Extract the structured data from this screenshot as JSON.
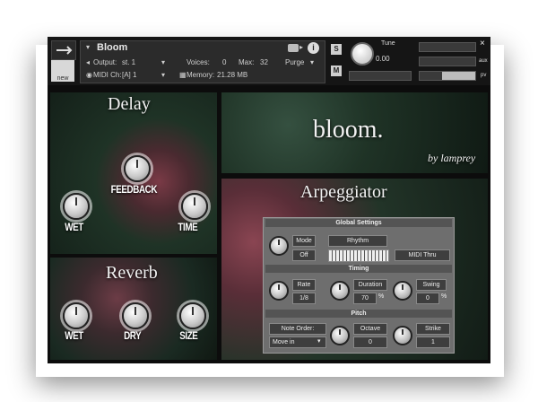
{
  "header": {
    "instrument_name": "Bloom",
    "output_label": "Output:",
    "output_value": "st. 1",
    "voices_label": "Voices:",
    "voices_value": "0",
    "max_label": "Max:",
    "max_value": "32",
    "purge_label": "Purge",
    "midi_label": "MIDI Ch:",
    "midi_value": "[A] 1",
    "memory_label": "Memory:",
    "memory_value": "21.28 MB",
    "new_label": "new",
    "s_label": "S",
    "m_label": "M",
    "tune_label": "Tune",
    "tune_value": "0.00",
    "aux_label": "aux",
    "pv_label": "pv",
    "close_glyph": "×"
  },
  "delay": {
    "title": "Delay",
    "feedback_label": "FEEDBACK",
    "wet_label": "WET",
    "time_label": "TIME"
  },
  "brand": {
    "title": "bloom.",
    "byline": "by lamprey"
  },
  "reverb": {
    "title": "Reverb",
    "wet_label": "WET",
    "dry_label": "DRY",
    "size_label": "SIZE"
  },
  "arpeggiator": {
    "title": "Arpeggiator",
    "global_header": "Global Settings",
    "mode_label": "Mode",
    "mode_value": "Off",
    "rhythm_label": "Rhythm",
    "midi_thru_label": "MIDI Thru",
    "timing_header": "Timing",
    "rate_label": "Rate",
    "rate_value": "1/8",
    "duration_label": "Duration",
    "duration_value": "70",
    "duration_unit": "%",
    "swing_label": "Swing",
    "swing_value": "0",
    "swing_unit": "%",
    "pitch_header": "Pitch",
    "note_order_label": "Note Order:",
    "note_order_value": "Move in",
    "octave_label": "Octave",
    "octave_value": "0",
    "strike_label": "Strike",
    "strike_value": "1"
  }
}
